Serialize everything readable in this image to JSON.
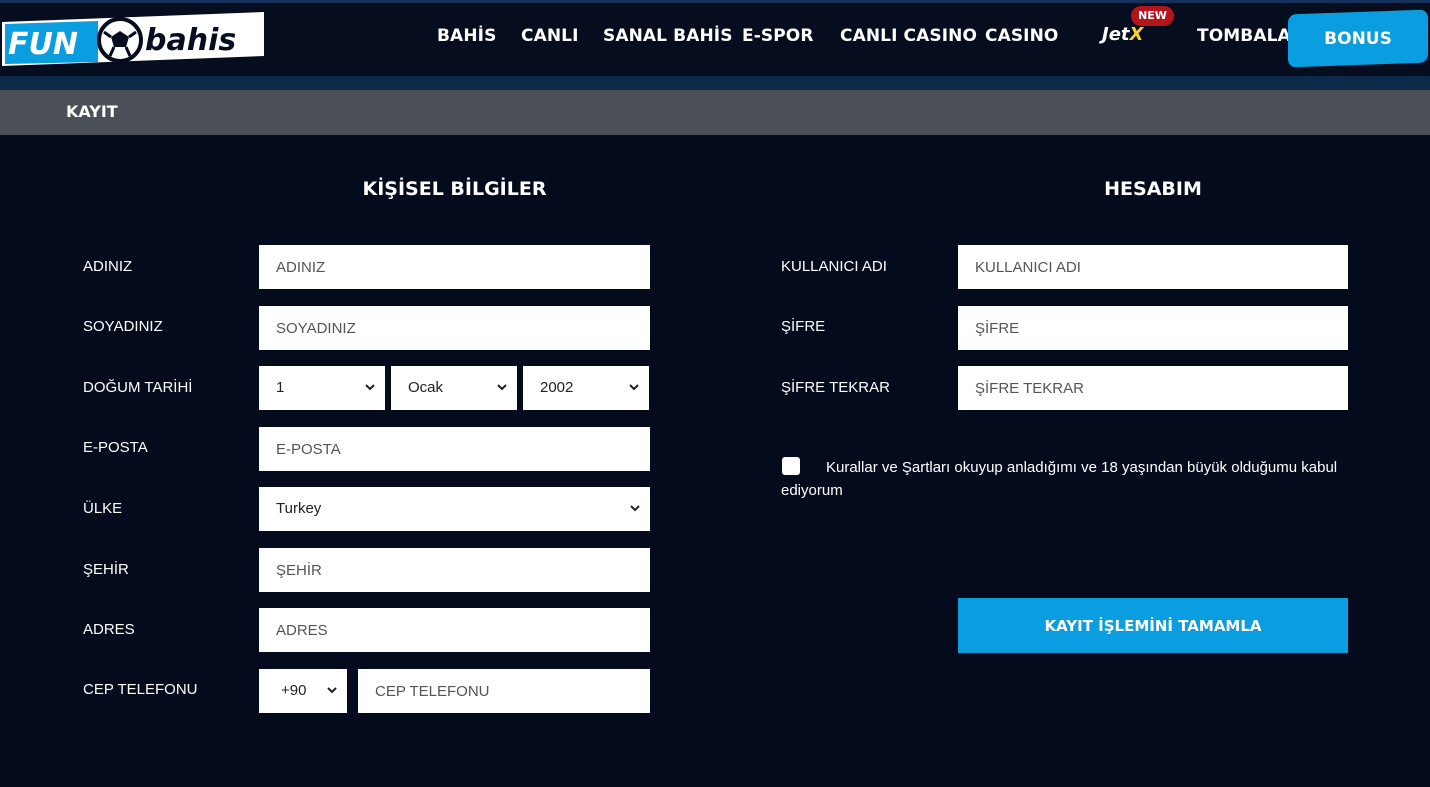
{
  "header": {
    "logo_text_left": "FUN",
    "logo_text_right": "bahis",
    "nav": [
      {
        "label": "BAHİS"
      },
      {
        "label": "CANLI"
      },
      {
        "label": "SANAL BAHİS"
      },
      {
        "label": "E-SPOR"
      },
      {
        "label": "CANLI CASINO"
      },
      {
        "label": "CASINO"
      },
      {
        "label": "TOMBALA"
      }
    ],
    "jetx": {
      "label_main": "Jet",
      "label_accent": "X",
      "badge": "NEW"
    },
    "bonus_label": "BONUS",
    "colors": {
      "accent": "#0a9de0",
      "background": "#040b1c",
      "badge": "#b4141b"
    }
  },
  "page_title": "KAYIT",
  "personal": {
    "title": "KİŞİSEL BİLGİLER",
    "first_name": {
      "label": "ADINIZ",
      "placeholder": "ADINIZ"
    },
    "last_name": {
      "label": "SOYADINIZ",
      "placeholder": "SOYADINIZ"
    },
    "birth_date": {
      "label": "DOĞUM TARİHİ",
      "day": "1",
      "month": "Ocak",
      "year": "2002"
    },
    "email": {
      "label": "E-POSTA",
      "placeholder": "E-POSTA"
    },
    "country": {
      "label": "ÜLKE",
      "value": "Turkey"
    },
    "city": {
      "label": "ŞEHİR",
      "placeholder": "ŞEHİR"
    },
    "address": {
      "label": "ADRES",
      "placeholder": "ADRES"
    },
    "mobile": {
      "label": "CEP TELEFONU",
      "code": "+90",
      "placeholder": "CEP TELEFONU"
    }
  },
  "account": {
    "title": "HESABIM",
    "username": {
      "label": "KULLANICI ADI",
      "placeholder": "KULLANICI ADI"
    },
    "password": {
      "label": "ŞİFRE",
      "placeholder": "ŞİFRE"
    },
    "password_repeat": {
      "label": "ŞİFRE TEKRAR",
      "placeholder": "ŞİFRE TEKRAR"
    },
    "terms_text": "Kurallar ve Şartları okuyup anladığımı ve 18 yaşından büyük olduğumu kabul ediyorum",
    "submit_label": "KAYIT İŞLEMİNİ TAMAMLA"
  }
}
